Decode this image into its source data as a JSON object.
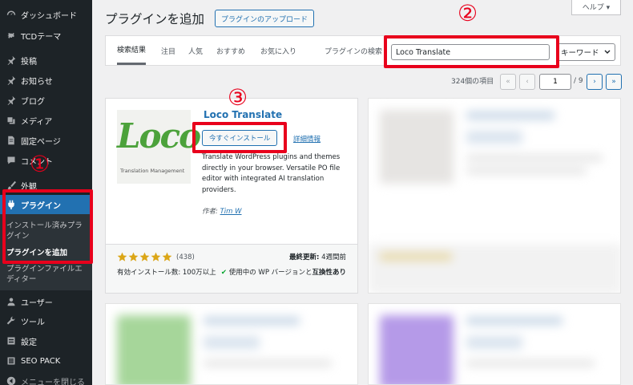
{
  "sidebar": {
    "items": [
      {
        "label": "ダッシュボード",
        "icon": "dashboard-icon"
      },
      {
        "label": "TCDテーマ",
        "icon": "gear-icon"
      },
      {
        "label": "投稿",
        "icon": "pin-icon"
      },
      {
        "label": "お知らせ",
        "icon": "pin-icon"
      },
      {
        "label": "ブログ",
        "icon": "pin-icon"
      },
      {
        "label": "メディア",
        "icon": "media-icon"
      },
      {
        "label": "固定ページ",
        "icon": "page-icon"
      },
      {
        "label": "コメント",
        "icon": "comment-icon"
      },
      {
        "label": "外観",
        "icon": "brush-icon"
      },
      {
        "label": "プラグイン",
        "icon": "plugin-icon"
      },
      {
        "label": "ユーザー",
        "icon": "user-icon"
      },
      {
        "label": "ツール",
        "icon": "wrench-icon"
      },
      {
        "label": "設定",
        "icon": "settings-icon"
      },
      {
        "label": "SEO PACK",
        "icon": "list-icon"
      },
      {
        "label": "メニューを閉じる",
        "icon": "collapse-icon"
      }
    ],
    "submenu": [
      {
        "label": "インストール済みプラグイン"
      },
      {
        "label": "プラグインを追加"
      },
      {
        "label": "プラグインファイルエディター"
      }
    ]
  },
  "header": {
    "title": "プラグインを追加",
    "upload_label": "プラグインのアップロード",
    "help_label": "ヘルプ ▾"
  },
  "filter": {
    "tabs": [
      "検索結果",
      "注目",
      "人気",
      "おすすめ",
      "お気に入り"
    ],
    "search_label": "プラグインの検索",
    "search_value": "Loco Translate",
    "search_type": "キーワード"
  },
  "pagination": {
    "count_text": "324個の項目",
    "first": "«",
    "prev": "‹",
    "current": "1",
    "total_text": "/ 9",
    "next": "›",
    "last": "»"
  },
  "plugin": {
    "logo_word": "Loco",
    "logo_sub": "Translation Management",
    "name": "Loco Translate",
    "install_label": "今すぐインストール",
    "details_label": "詳細情報",
    "description": "Translate WordPress plugins and themes directly in your browser. Versatile PO file editor with integrated AI translation providers.",
    "author_prefix": "作者: ",
    "author_name": "Tim W",
    "rating": 5,
    "rating_count": "(438)",
    "installs": "有効インストール数: 100万以上",
    "updated_label": "最終更新:",
    "updated_value": "4週間前",
    "compat_prefix": "使用中の WP バージョンと",
    "compat_bold": "互換性あり"
  },
  "annotations": [
    "①",
    "②",
    "③"
  ],
  "colors": {
    "sidebar_bg": "#1d2327",
    "accent": "#2271b1",
    "annotation_red": "#e8001c",
    "star": "#dba617",
    "check": "#00a32a"
  }
}
